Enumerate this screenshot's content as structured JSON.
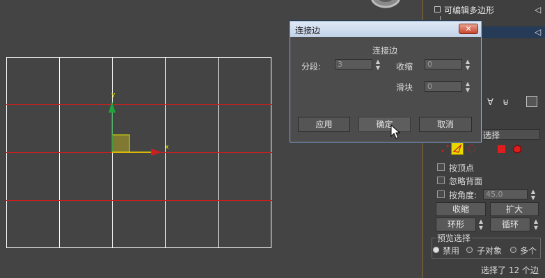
{
  "dialog": {
    "title": "连接边",
    "group_label": "连接边",
    "segments_label": "分段:",
    "segments_value": "3",
    "pinch_label": "收缩",
    "pinch_value": "0",
    "slide_label": "滑块",
    "slide_value": "0",
    "apply_label": "应用",
    "ok_label": "确定",
    "cancel_label": "取消",
    "close_glyph": "✕"
  },
  "viewport": {
    "axis_y_label": "y",
    "axis_x_label": "x",
    "grid_color": "#ffffff",
    "line_color": "#cc1f1f",
    "axis_y_color": "#1fa33a",
    "axis_x_color": "#e6e600"
  },
  "command_panel": {
    "stack_item_1": "可编辑多边形",
    "selection_rollout": "选择",
    "by_vertex": "按顶点",
    "ignore_backfacing": "忽略背面",
    "by_angle": "按角度:",
    "by_angle_value": "45.0",
    "shrink": "收缩",
    "grow": "扩大",
    "ring": "环形",
    "loop": "循环",
    "preview_group": "预览选择",
    "preview_off": "禁用",
    "preview_subobject": "子对象",
    "preview_multi": "多个",
    "status": "选择了 12 个边"
  }
}
